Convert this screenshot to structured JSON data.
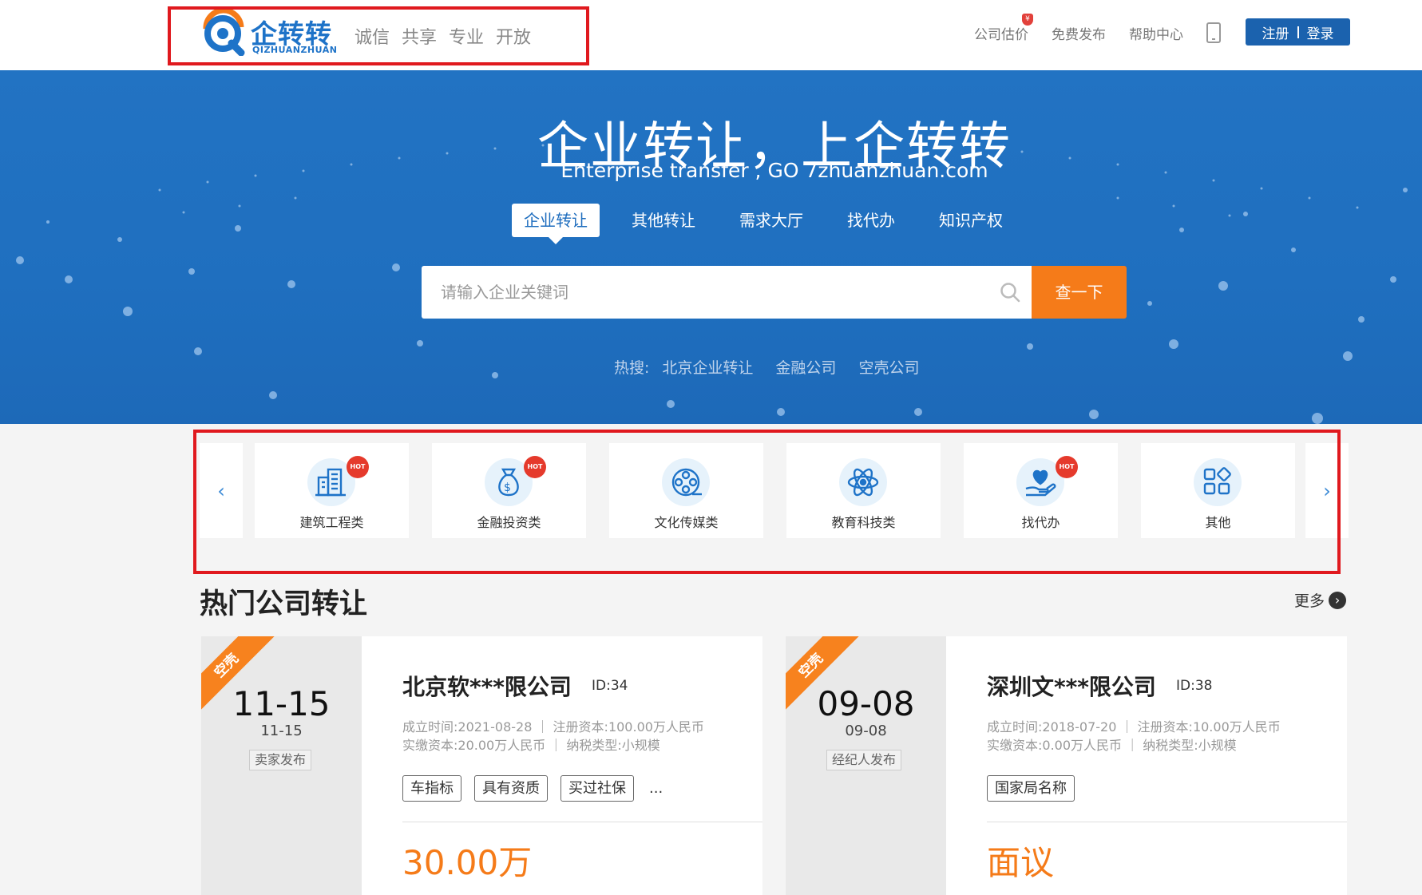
{
  "header": {
    "logo_text": "企转转",
    "logo_sub": "QIZHUANZHUAN",
    "slogans": [
      "诚信",
      "共享",
      "专业",
      "开放"
    ],
    "links": [
      "公司估价",
      "免费发布",
      "帮助中心"
    ],
    "badge": "¥",
    "register": "注册",
    "login": "登录"
  },
  "hero": {
    "title": "企业转让，上企转转",
    "subtitle": "Enterprise transfer , GO 7zhuanzhuan.com",
    "tabs": [
      "企业转让",
      "其他转让",
      "需求大厅",
      "找代办",
      "知识产权"
    ],
    "active_tab": "企业转让",
    "search_placeholder": "请输入企业关键词",
    "search_button": "查一下",
    "hot_label": "热搜:",
    "hot_items": [
      "北京企业转让",
      "金融公司",
      "空壳公司"
    ]
  },
  "categories": {
    "prev": "‹",
    "next": "›",
    "items": [
      {
        "label": "建筑工程类",
        "icon": "building-icon",
        "hot": "HOT"
      },
      {
        "label": "金融投资类",
        "icon": "money-bag-icon",
        "hot": "HOT"
      },
      {
        "label": "文化传媒类",
        "icon": "film-reel-icon",
        "hot": ""
      },
      {
        "label": "教育科技类",
        "icon": "atom-icon",
        "hot": ""
      },
      {
        "label": "找代办",
        "icon": "heart-hand-icon",
        "hot": "HOT"
      },
      {
        "label": "其他",
        "icon": "apps-grid-icon",
        "hot": ""
      }
    ]
  },
  "section": {
    "title": "热门公司转让",
    "more": "更多",
    "more_icon": "›"
  },
  "listings": [
    {
      "ribbon": "空壳",
      "date_big": "11-15",
      "date_small": "11-15",
      "publisher": "卖家发布",
      "name": "北京软***限公司",
      "id": "ID:34",
      "info_1": "成立时间:2021-08-28 ｜ 注册资本:100.00万人民币",
      "info_2": "实缴资本:20.00万人民币 ｜ 纳税类型:小规模",
      "tags": [
        "车指标",
        "具有资质",
        "买过社保"
      ],
      "more_tags": "...",
      "price": "30.00万"
    },
    {
      "ribbon": "空壳",
      "date_big": "09-08",
      "date_small": "09-08",
      "publisher": "经纪人发布",
      "name": "深圳文***限公司",
      "id": "ID:38",
      "info_1": "成立时间:2018-07-20 ｜ 注册资本:10.00万人民币",
      "info_2": "实缴资本:0.00万人民币 ｜ 纳税类型:小规模",
      "tags": [
        "国家局名称"
      ],
      "price": "面议"
    }
  ],
  "colors": {
    "brand_blue": "#1e73c8",
    "hero_blue": "#2273c3",
    "accent_orange": "#f57b19",
    "highlight_red": "#e0191e"
  }
}
